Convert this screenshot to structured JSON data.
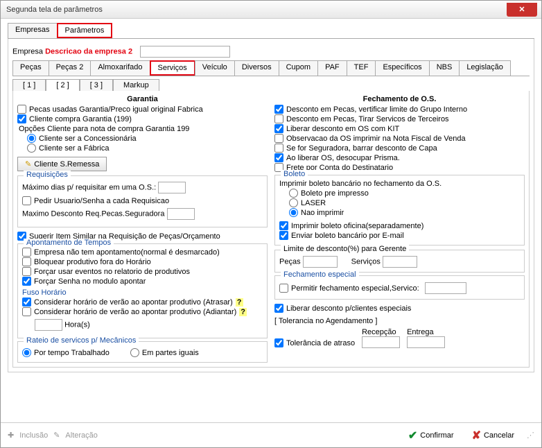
{
  "window": {
    "title": "Segunda tela de parâmetros"
  },
  "topTabs": {
    "empresas": "Empresas",
    "parametros": "Parâmetros"
  },
  "empresaLabel": "Empresa",
  "empresaDesc": "Descricao da empresa 2",
  "catTabs": [
    "Peças",
    "Peças 2",
    "Almoxarifado",
    "Serviços",
    "Veículo",
    "Diversos",
    "Cupom",
    "PAF",
    "TEF",
    "Específicos",
    "NBS",
    "Legislação"
  ],
  "catActive": 3,
  "subTabs": [
    "[ 1 ]",
    "[ 2 ]",
    "[ 3 ]",
    "Markup"
  ],
  "subActive": 1,
  "left": {
    "title": "Garantia",
    "c1": "Pecas usadas Garantia/Preco igual original Fabrica",
    "c2": "Cliente compra Garantia (199)",
    "optTitle": "Opções Cliente para nota de compra Garantia 199",
    "o1": "Cliente ser a Concessionária",
    "o2": "Cliente ser a Fábrica",
    "btnRemessa": "Cliente S.Remessa",
    "reqTitle": "Requisições",
    "reqMax": "Máximo dias p/ requisitar em uma O.S.:",
    "reqPedir": "Pedir Usuario/Senha a cada Requisicao",
    "reqDesc": "Maximo Desconto Req.Pecas.Seguradora",
    "sugerir": "Sugerir Item Similar na Requisição de Peças/Orçamento",
    "apTitle": "Apontamento de Tempos",
    "ap1": "Empresa não tem apontamento(normal é desmarcado)",
    "ap2": "Bloquear produtivo fora do Horário",
    "ap3": "Forçar usar eventos no relatorio de produtivos",
    "ap4": "Forçar Senha no modulo apontar",
    "fusoTitle": "Fuso Horário",
    "fuso1": "Considerar horário de verão ao apontar produtivo (Atrasar)",
    "fuso2": "Considerar horário de verão ao apontar produtivo (Adiantar)",
    "horas": "Hora(s)",
    "rateioTitle": "Rateio de servicos p/ Mecânicos",
    "r1": "Por tempo Trabalhado",
    "r2": "Em partes iguais"
  },
  "right": {
    "title": "Fechamento de O.S.",
    "c1": "Desconto em Pecas, vertificar limite do Grupo Interno",
    "c2": "Desconto em Pecas, Tirar Servicos de Terceiros",
    "c3": "Liberar desconto em OS com KIT",
    "c4": "Observacao da OS imprimir na Nota Fiscal de Venda",
    "c5": "Se for Seguradora, barrar desconto de Capa",
    "c6": "Ao liberar OS, desocupar Prisma.",
    "c7": "Frete por Conta do Destinatario",
    "bolTitle": "Boleto",
    "bolImp": "Imprimir boleto bancário no fechamento da O.S.",
    "b1": "Boleto pre impresso",
    "b2": "LASER",
    "b3": "Nao imprimir",
    "bolOf": "Imprimir boleto oficina(separadamente)",
    "bolEmail": "Enviar boleto bancário por E-mail",
    "lim": "Limite de desconto(%) para Gerente",
    "limP": "Peças",
    "limS": "Serviços",
    "fechTitle": "Fechamento especial",
    "fech1": "Permitir fechamento especial,Servico:",
    "libEsp": "Liberar desconto p/clientes especiais",
    "tolTitle": "[ Tolerancia no Agendamento ]",
    "tolAtraso": "Tolerância de atraso",
    "tolRec": "Recepção",
    "tolEnt": "Entrega"
  },
  "footer": {
    "inc": "Inclusão",
    "alt": "Alteração",
    "ok": "Confirmar",
    "cancel": "Cancelar"
  }
}
